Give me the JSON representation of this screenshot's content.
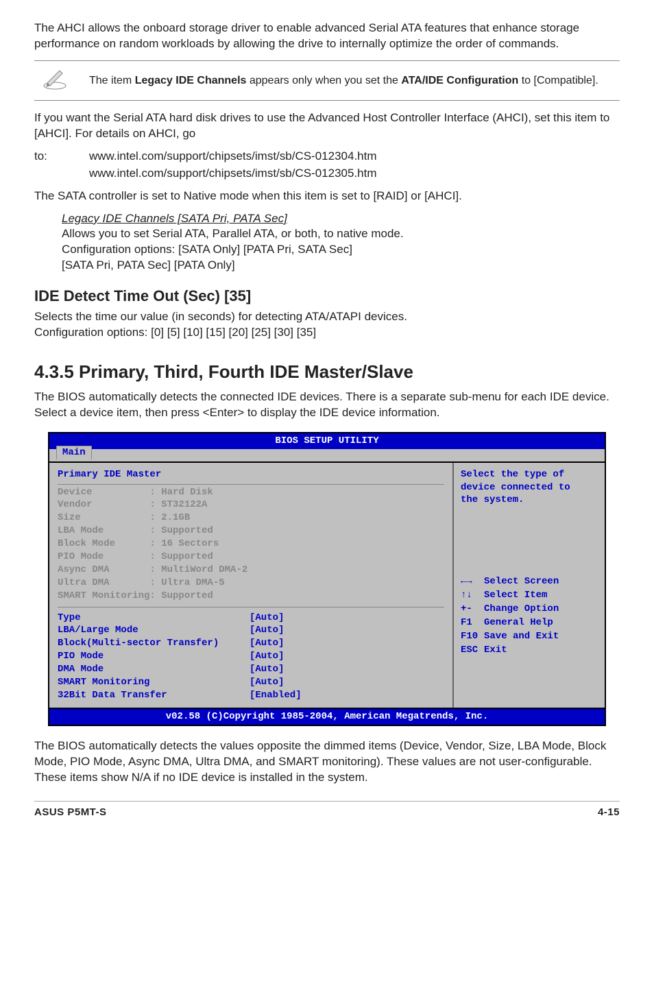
{
  "intro_para": "The AHCI allows the onboard storage driver to enable advanced Serial ATA features that enhance storage performance on random workloads by allowing the drive to internally optimize the order of commands.",
  "note": {
    "prefix": "The item ",
    "bold1": "Legacy IDE Channels",
    "mid": " appears only when you set the ",
    "bold2": "ATA/IDE Configuration",
    "suffix": " to [Compatible]."
  },
  "ahci_para": "If you want the Serial ATA hard disk drives to use the Advanced Host Controller Interface (AHCI), set this item to [AHCI]. For details on AHCI, go",
  "to_label": "to:",
  "url1": "www.intel.com/support/chipsets/imst/sb/CS-012304.htm",
  "url2": "www.intel.com/support/chipsets/imst/sb/CS-012305.htm",
  "native_para": "The SATA controller is set to Native mode when this item is set to [RAID] or [AHCI].",
  "legacy": {
    "heading": "Legacy IDE Channels [SATA Pri, PATA Sec]",
    "line1": "Allows you to set Serial ATA, Parallel ATA, or both, to native mode.",
    "line2": "Configuration options: [SATA Only] [PATA Pri, SATA Sec]",
    "line3": "[SATA Pri, PATA Sec] [PATA Only]"
  },
  "detect": {
    "heading": "IDE Detect Time Out (Sec) [35]",
    "line1": "Selects the time our value (in seconds) for detecting ATA/ATAPI devices.",
    "line2": "Configuration options: [0] [5] [10] [15] [20] [25] [30] [35]"
  },
  "section": {
    "heading": "4.3.5   Primary, Third, Fourth IDE Master/Slave",
    "para": "The BIOS automatically detects the connected IDE devices. There is a separate sub-menu for each IDE device. Select a device item, then press <Enter> to display the IDE device information."
  },
  "bios": {
    "title": "BIOS SETUP UTILITY",
    "tab": "Main",
    "panel_title": "Primary IDE Master",
    "info": [
      "Device          : Hard Disk",
      "Vendor          : ST32122A",
      "Size            : 2.1GB",
      "LBA Mode        : Supported",
      "Block Mode      : 16 Sectors",
      "PIO Mode        : Supported",
      "Async DMA       : MultiWord DMA-2",
      "Ultra DMA       : Ultra DMA-5",
      "SMART Monitoring: Supported"
    ],
    "settings": [
      {
        "label": "Type",
        "value": "[Auto]"
      },
      {
        "label": "LBA/Large Mode",
        "value": "[Auto]"
      },
      {
        "label": "Block(Multi-sector Transfer)",
        "value": "[Auto]"
      },
      {
        "label": "PIO Mode",
        "value": "[Auto]"
      },
      {
        "label": "DMA Mode",
        "value": "[Auto]"
      },
      {
        "label": "SMART Monitoring",
        "value": "[Auto]"
      },
      {
        "label": "32Bit Data Transfer",
        "value": "[Enabled]"
      }
    ],
    "help_top1": "Select the type of",
    "help_top2": "device connected to",
    "help_top3": "the system.",
    "help_keys": [
      {
        "key": "←→",
        "label": "Select Screen"
      },
      {
        "key": "↑↓",
        "label": "Select Item"
      },
      {
        "key": "+-",
        "label": "Change Option"
      },
      {
        "key": "F1",
        "label": "General Help"
      },
      {
        "key": "F10",
        "label": "Save and Exit"
      },
      {
        "key": "ESC",
        "label": "Exit"
      }
    ],
    "footer": "v02.58 (C)Copyright 1985-2004, American Megatrends, Inc."
  },
  "closing_para": "The BIOS automatically detects the values opposite the dimmed items (Device, Vendor, Size, LBA Mode, Block Mode, PIO Mode, Async DMA, Ultra DMA, and SMART monitoring). These values are not user-configurable. These items show N/A if no IDE device is installed in the system.",
  "footer_left": "ASUS P5MT-S",
  "footer_right": "4-15"
}
